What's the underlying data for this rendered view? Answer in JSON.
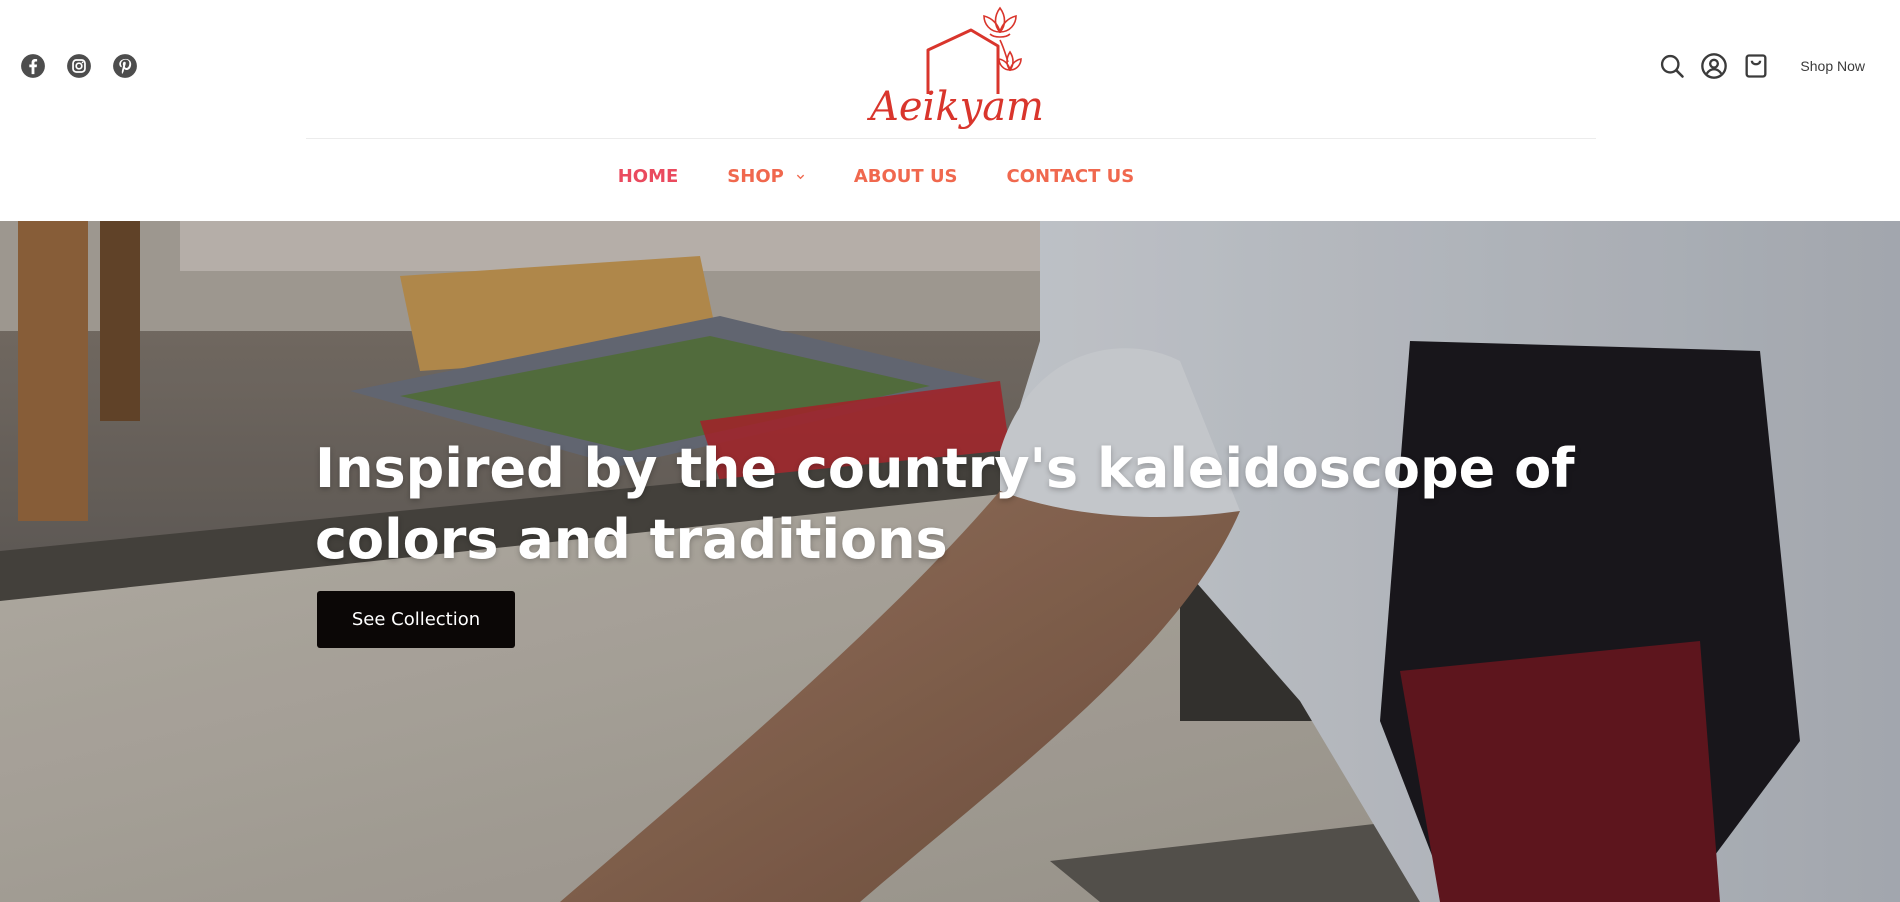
{
  "header": {
    "social": [
      {
        "icon": "facebook-icon"
      },
      {
        "icon": "instagram-icon"
      },
      {
        "icon": "pinterest-icon"
      }
    ],
    "logo": {
      "text": "Aeikyam",
      "icon": "house-lotus-logo"
    },
    "actions": {
      "search_icon": "search-icon",
      "account_icon": "user-icon",
      "cart_icon": "shopping-bag-icon",
      "shop_now_label": "Shop Now"
    }
  },
  "nav": {
    "items": [
      {
        "label": "HOME",
        "active": true
      },
      {
        "label": "SHOP",
        "has_dropdown": true
      },
      {
        "label": "ABOUT US"
      },
      {
        "label": "CONTACT US"
      }
    ]
  },
  "hero": {
    "title": "Inspired by the country's kaleidoscope of colors and traditions",
    "cta_label": "See Collection"
  },
  "colors": {
    "brand_red": "#d9352c",
    "nav_orange": "#f0684e",
    "nav_active": "#ea4a5e",
    "button_dark": "#0b0706"
  }
}
